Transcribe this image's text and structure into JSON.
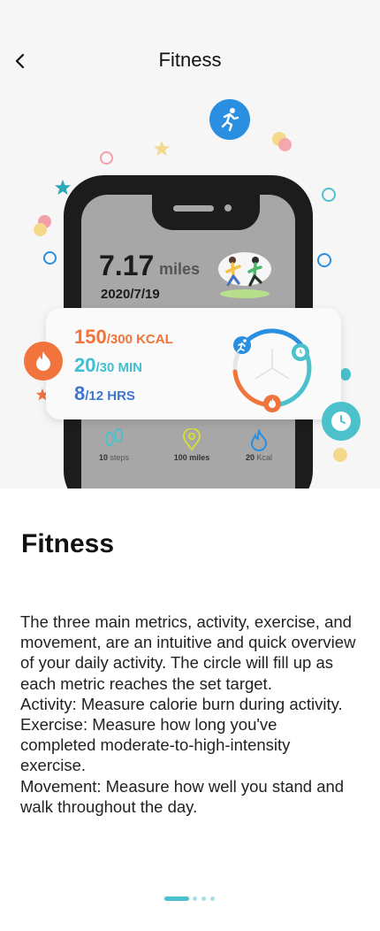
{
  "header": {
    "title": "Fitness",
    "back_icon": "chevron-left-icon"
  },
  "illustration": {
    "miles_value": "7.17",
    "miles_unit": "miles",
    "date": "2020/7/19",
    "metrics": [
      {
        "value": "150",
        "target": "/300 KCAL",
        "color": "#f0743b"
      },
      {
        "value": "20",
        "target": "/30 MIN",
        "color": "#3fbfcf"
      },
      {
        "value": "8",
        "target": "/12 HRS",
        "color": "#3f76cf"
      }
    ],
    "stats": [
      {
        "value": "10",
        "unit": "steps",
        "icon": "footprints-icon"
      },
      {
        "value": "100",
        "unit": "miles",
        "icon": "location-pin-icon"
      },
      {
        "value": "20",
        "unit": "Kcal",
        "icon": "flame-icon"
      }
    ]
  },
  "content": {
    "title": "Fitness",
    "paragraphs": [
      "The three main metrics, activity, exercise, and movement, are an intuitive and quick overview of your daily activity. The circle will fill up as each metric reaches the set target.",
      "Activity: Measure calorie burn during activity.",
      "Exercise: Measure how long you've completed moderate-to-high-intensity exercise.",
      "Movement: Measure how well you stand and walk throughout the day."
    ]
  },
  "pager": {
    "pages": 4,
    "current": 1
  },
  "colors": {
    "orange": "#f0743b",
    "teal": "#4cc1cc",
    "blue": "#2a8fe0"
  }
}
